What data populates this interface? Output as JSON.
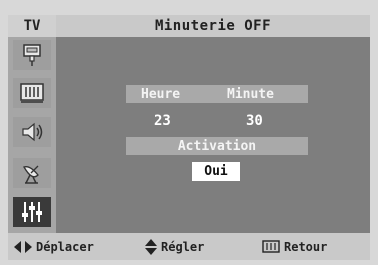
{
  "header": {
    "tv_label": "TV",
    "title": "Minuterie OFF"
  },
  "sidebar": {
    "items": [
      {
        "icon": "input-source-icon",
        "active": false
      },
      {
        "icon": "picture-icon",
        "active": false
      },
      {
        "icon": "sound-icon",
        "active": false
      },
      {
        "icon": "channel-antenna-icon",
        "active": false
      },
      {
        "icon": "setup-sliders-icon",
        "active": true
      }
    ]
  },
  "timer": {
    "hour_label": "Heure",
    "minute_label": "Minute",
    "hour_value": "23",
    "minute_value": "30",
    "activation_label": "Activation",
    "activation_value": "Oui"
  },
  "footer": {
    "move_label": "Déplacer",
    "adjust_label": "Régler",
    "return_label": "Retour"
  }
}
